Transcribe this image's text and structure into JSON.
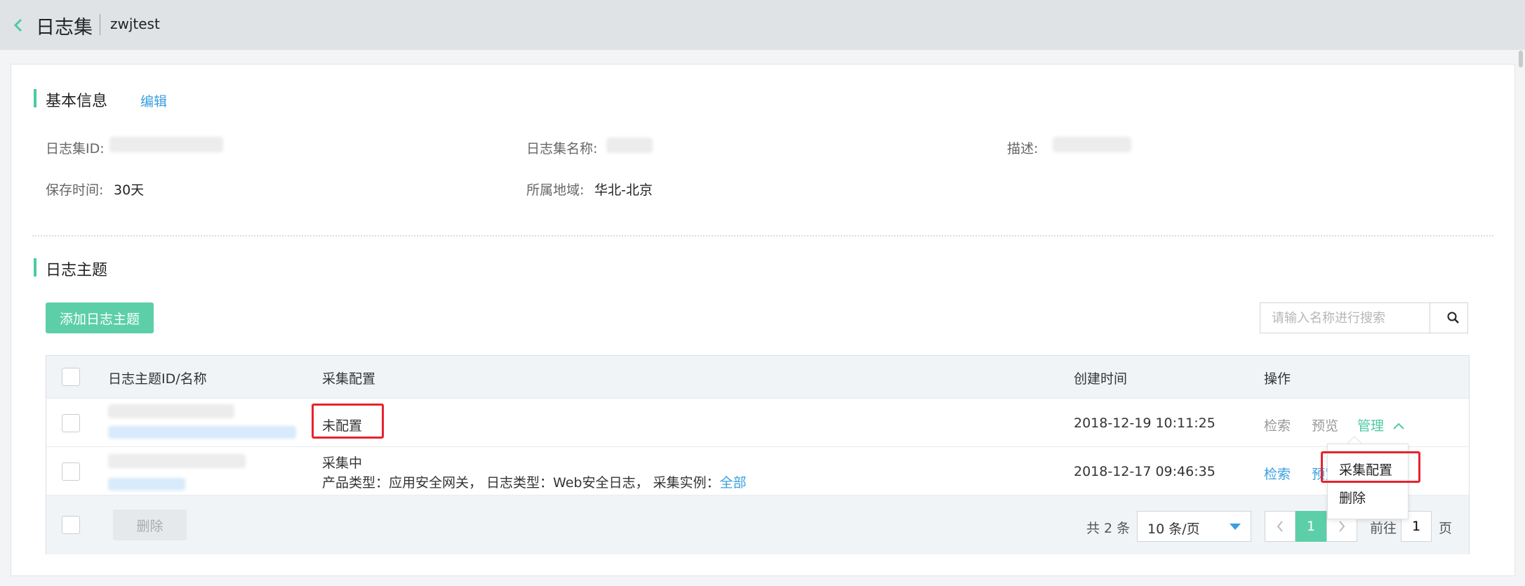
{
  "header": {
    "title": "日志集",
    "subtitle": "zwjtest"
  },
  "basic_info": {
    "section_title": "基本信息",
    "edit_label": "编辑",
    "fields": {
      "id_label": "日志集ID:",
      "name_label": "日志集名称:",
      "desc_label": "描述:",
      "retention_label": "保存时间:",
      "retention_value": "30天",
      "region_label": "所属地域:",
      "region_value": "华北-北京"
    }
  },
  "topics": {
    "section_title": "日志主题",
    "add_button": "添加日志主题",
    "search_placeholder": "请输入名称进行搜索",
    "columns": [
      "日志主题ID/名称",
      "采集配置",
      "创建时间",
      "操作"
    ],
    "rows": [
      {
        "config": "未配置",
        "created": "2018-12-19 10:11:25",
        "actions": {
          "search": "检索",
          "preview": "预览",
          "manage": "管理"
        }
      },
      {
        "config": "采集中",
        "detail_prefix": "产品类型：应用安全网关， 日志类型：Web安全日志， 采集实例：",
        "detail_link": "全部",
        "created": "2018-12-17 09:46:35",
        "actions": {
          "search": "检索",
          "preview": "预览"
        }
      }
    ],
    "manage_menu": [
      "采集配置",
      "删除"
    ],
    "footer": {
      "delete_button": "删除",
      "total": "共 2 条",
      "page_size": "10 条/页",
      "current_page": "1",
      "goto_label": "前往",
      "goto_value": "1",
      "page_suffix": "页"
    }
  },
  "colors": {
    "accent": "#5ccfa9",
    "link": "#3a9fe0",
    "highlight": "#e6232e"
  }
}
